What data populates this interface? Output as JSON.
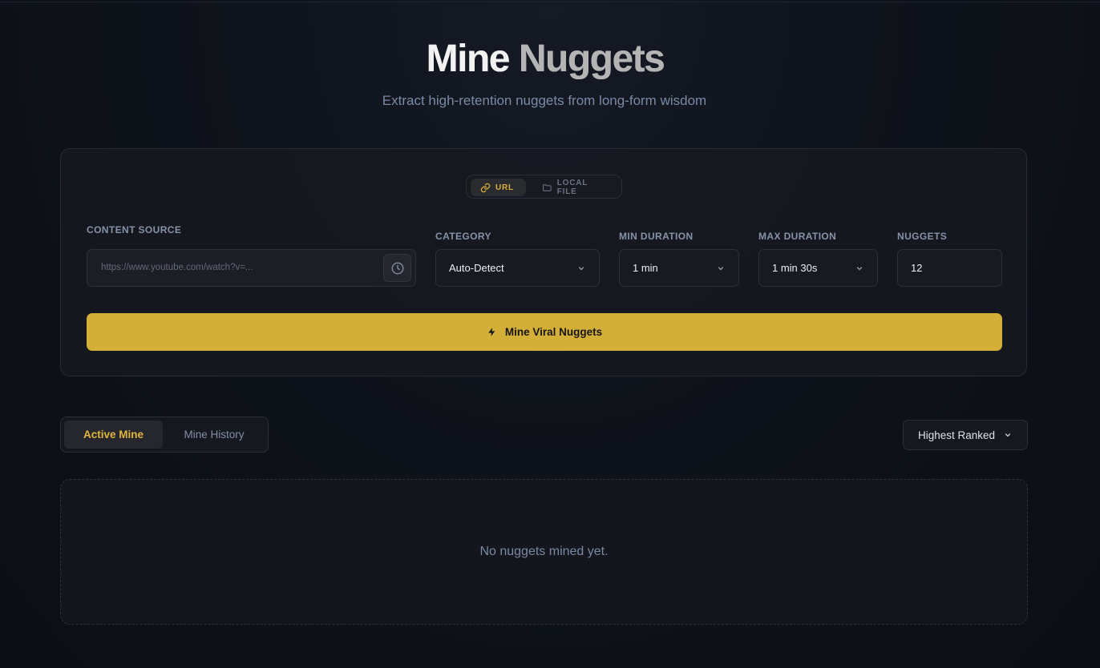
{
  "header": {
    "title_part1": "Mine",
    "title_part2": "Nuggets",
    "subtitle": "Extract high-retention nuggets from long-form wisdom"
  },
  "source_toggle": {
    "options": [
      {
        "label": "URL",
        "icon": "link-icon",
        "selected": true
      },
      {
        "label": "LOCAL FILE",
        "icon": "folder-icon",
        "selected": false
      }
    ]
  },
  "form": {
    "content_source": {
      "label": "CONTENT SOURCE",
      "placeholder": "https://www.youtube.com/watch?v=...",
      "value": "",
      "history_icon": "clock-icon"
    },
    "category": {
      "label": "CATEGORY",
      "value": "Auto-Detect"
    },
    "min_duration": {
      "label": "MIN DURATION",
      "value": "1 min"
    },
    "max_duration": {
      "label": "MAX DURATION",
      "value": "1 min 30s"
    },
    "nuggets": {
      "label": "NUGGETS",
      "value": "12"
    }
  },
  "actions": {
    "mine_label": "Mine Viral Nuggets",
    "mine_icon": "lightning-icon"
  },
  "results": {
    "tabs": [
      {
        "label": "Active Mine",
        "active": true
      },
      {
        "label": "Mine History",
        "active": false
      }
    ],
    "sort": {
      "value": "Highest Ranked"
    },
    "empty_message": "No nuggets mined yet."
  },
  "colors": {
    "accent": "#d4af37",
    "background": "#0f131b",
    "muted_text": "#7a89a4"
  }
}
